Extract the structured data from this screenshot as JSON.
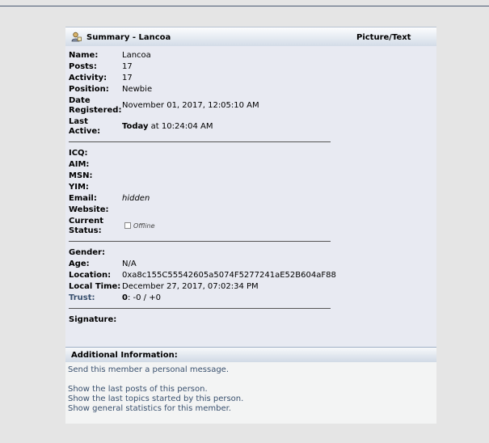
{
  "header": {
    "title": "Summary - Lancoa",
    "right_label": "Picture/Text",
    "icon": "user-icon"
  },
  "summary": {
    "name": {
      "label": "Name:",
      "value": "Lancoa"
    },
    "posts": {
      "label": "Posts:",
      "value": "17"
    },
    "activity": {
      "label": "Activity:",
      "value": "17"
    },
    "position": {
      "label": "Position:",
      "value": "Newbie"
    },
    "date_registered": {
      "label_line1": "Date",
      "label_line2": "Registered:",
      "value": "November 01, 2017, 12:05:10 AM"
    },
    "last_active": {
      "label_line1": "Last",
      "label_line2": "Active:",
      "value_bold": "Today",
      "value_rest": " at 10:24:04 AM"
    }
  },
  "contact": {
    "icq": {
      "label": "ICQ:",
      "value": ""
    },
    "aim": {
      "label": "AIM:",
      "value": ""
    },
    "msn": {
      "label": "MSN:",
      "value": ""
    },
    "yim": {
      "label": "YIM:",
      "value": ""
    },
    "email": {
      "label": "Email:",
      "value": "hidden"
    },
    "website": {
      "label": "Website:",
      "value": ""
    },
    "current_status": {
      "label_line1": "Current",
      "label_line2": "Status:",
      "value": "Offline"
    }
  },
  "personal": {
    "gender": {
      "label": "Gender:",
      "value": ""
    },
    "age": {
      "label": "Age:",
      "value": "N/A"
    },
    "location": {
      "label": "Location:",
      "value": "0xa8c155C55542605a5074F5277241aE52B604aF88"
    },
    "local_time": {
      "label": "Local Time:",
      "value": "December 27, 2017, 07:02:34 PM"
    },
    "trust": {
      "label": "Trust:",
      "value_bold": "0",
      "value_rest": ": -0 / +0"
    }
  },
  "signature": {
    "label": "Signature:"
  },
  "additional": {
    "title": "Additional Information:",
    "links": [
      "Send this member a personal message.",
      "Show the last posts of this person.",
      "Show the last topics started by this person.",
      "Show general statistics for this member."
    ]
  }
}
